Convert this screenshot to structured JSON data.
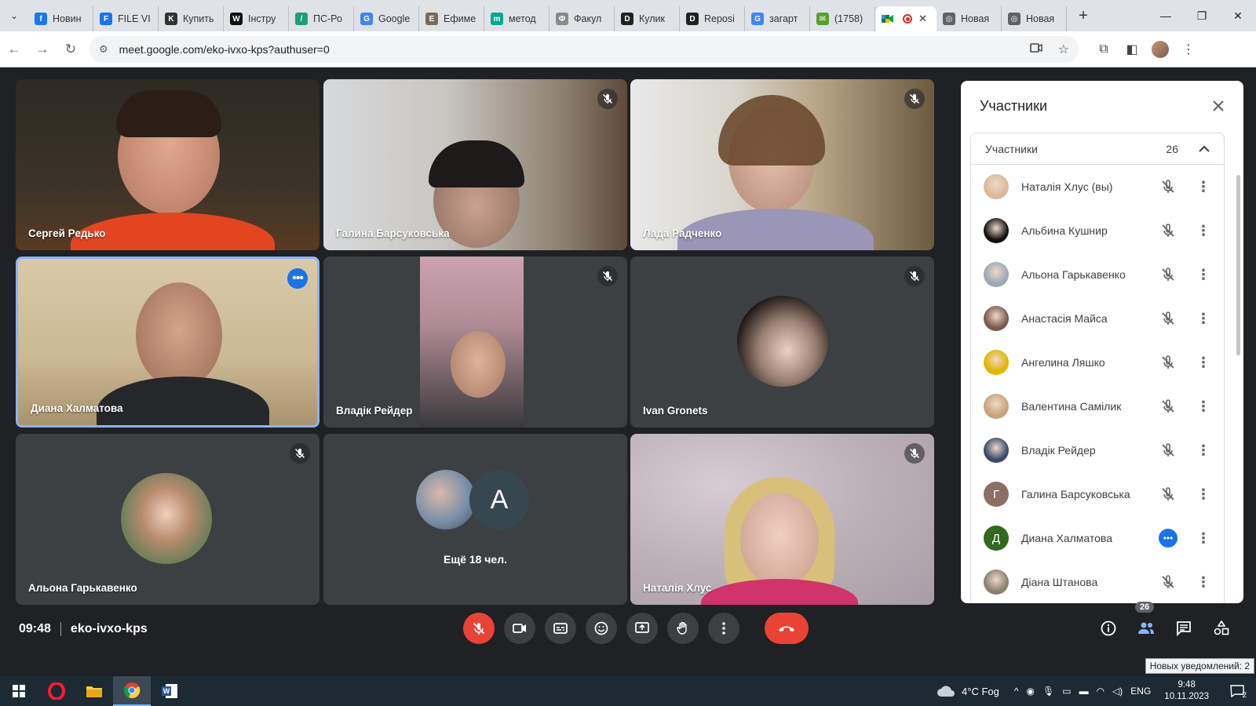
{
  "browser": {
    "tabs": [
      {
        "title": "Новин",
        "fav_color": "#1877f2",
        "fav_glyph": "f"
      },
      {
        "title": "FILE VI",
        "fav_color": "#1a73e8",
        "fav_glyph": "F"
      },
      {
        "title": "Купить",
        "fav_color": "#333333",
        "fav_glyph": "K"
      },
      {
        "title": "Інстру",
        "fav_color": "#111111",
        "fav_glyph": "W"
      },
      {
        "title": "ПС-Ро",
        "fav_color": "#1a9e7a",
        "fav_glyph": "/"
      },
      {
        "title": "Google",
        "fav_color": "#4285f4",
        "fav_glyph": "G"
      },
      {
        "title": "Ефиме",
        "fav_color": "#7a6a5a",
        "fav_glyph": "E"
      },
      {
        "title": "метод",
        "fav_color": "#00a98f",
        "fav_glyph": "m"
      },
      {
        "title": "Факул",
        "fav_color": "#8a8a8a",
        "fav_glyph": "Ф"
      },
      {
        "title": "Кулик",
        "fav_color": "#222222",
        "fav_glyph": "D"
      },
      {
        "title": "Reposi",
        "fav_color": "#222222",
        "fav_glyph": "D"
      },
      {
        "title": "загарт",
        "fav_color": "#4285f4",
        "fav_glyph": "G"
      },
      {
        "title": "(1758)",
        "fav_color": "#5aa02c",
        "fav_glyph": "✉"
      }
    ],
    "trailing_tabs": [
      {
        "title": "Новая",
        "fav_color": "#5f6368",
        "fav_glyph": "◎"
      },
      {
        "title": "Новая",
        "fav_color": "#5f6368",
        "fav_glyph": "◎"
      }
    ],
    "url": "meet.google.com/eko-ivxo-kps?authuser=0"
  },
  "meet": {
    "tiles": [
      {
        "name": "Сергей Редько"
      },
      {
        "name": "Галина Барсуковська"
      },
      {
        "name": "Лада Радченко"
      },
      {
        "name": "Диана Халматова"
      },
      {
        "name": "Владік Рейдер"
      },
      {
        "name": "Ivan Gronets"
      },
      {
        "name": "Альона Гарькавенко"
      },
      {
        "name": "Ещё 18 чел.",
        "initial": "А"
      },
      {
        "name": "Наталія Хлус"
      }
    ],
    "panel": {
      "title": "Участники",
      "section_label": "Участники",
      "count": "26",
      "participants": [
        {
          "name": "Наталія Хлус (вы)",
          "avatar": "photo",
          "color": "#d9b99a"
        },
        {
          "name": "Альбина Кушнир",
          "avatar": "photo",
          "color": "#111111"
        },
        {
          "name": "Альона Гарькавенко",
          "avatar": "photo",
          "color": "#9aa7b5"
        },
        {
          "name": "Анастасія Майса",
          "avatar": "photo",
          "color": "#7a5a4a"
        },
        {
          "name": "Ангелина Ляшко",
          "avatar": "photo",
          "color": "#e2b500"
        },
        {
          "name": "Валентина Самілик",
          "avatar": "photo",
          "color": "#c8a27a"
        },
        {
          "name": "Владік Рейдер",
          "avatar": "photo",
          "color": "#3a4a6a"
        },
        {
          "name": "Галина Барсуковська",
          "avatar": "letter",
          "letter": "Г",
          "color": "#8d6e63"
        },
        {
          "name": "Диана Халматова",
          "avatar": "letter",
          "letter": "Д",
          "color": "#33691e",
          "speaking": true
        },
        {
          "name": "Діана Штанова",
          "avatar": "photo",
          "color": "#8a8070"
        }
      ]
    },
    "bottom": {
      "time": "09:48",
      "meeting_code": "eko-ivxo-kps",
      "people_badge": "26",
      "tooltip": "Новых уведомлений: 2"
    }
  },
  "taskbar": {
    "weather": "4°C  Fog",
    "lang": "ENG",
    "time": "9:48",
    "date": "10.11.2023",
    "notif_count": "2"
  }
}
